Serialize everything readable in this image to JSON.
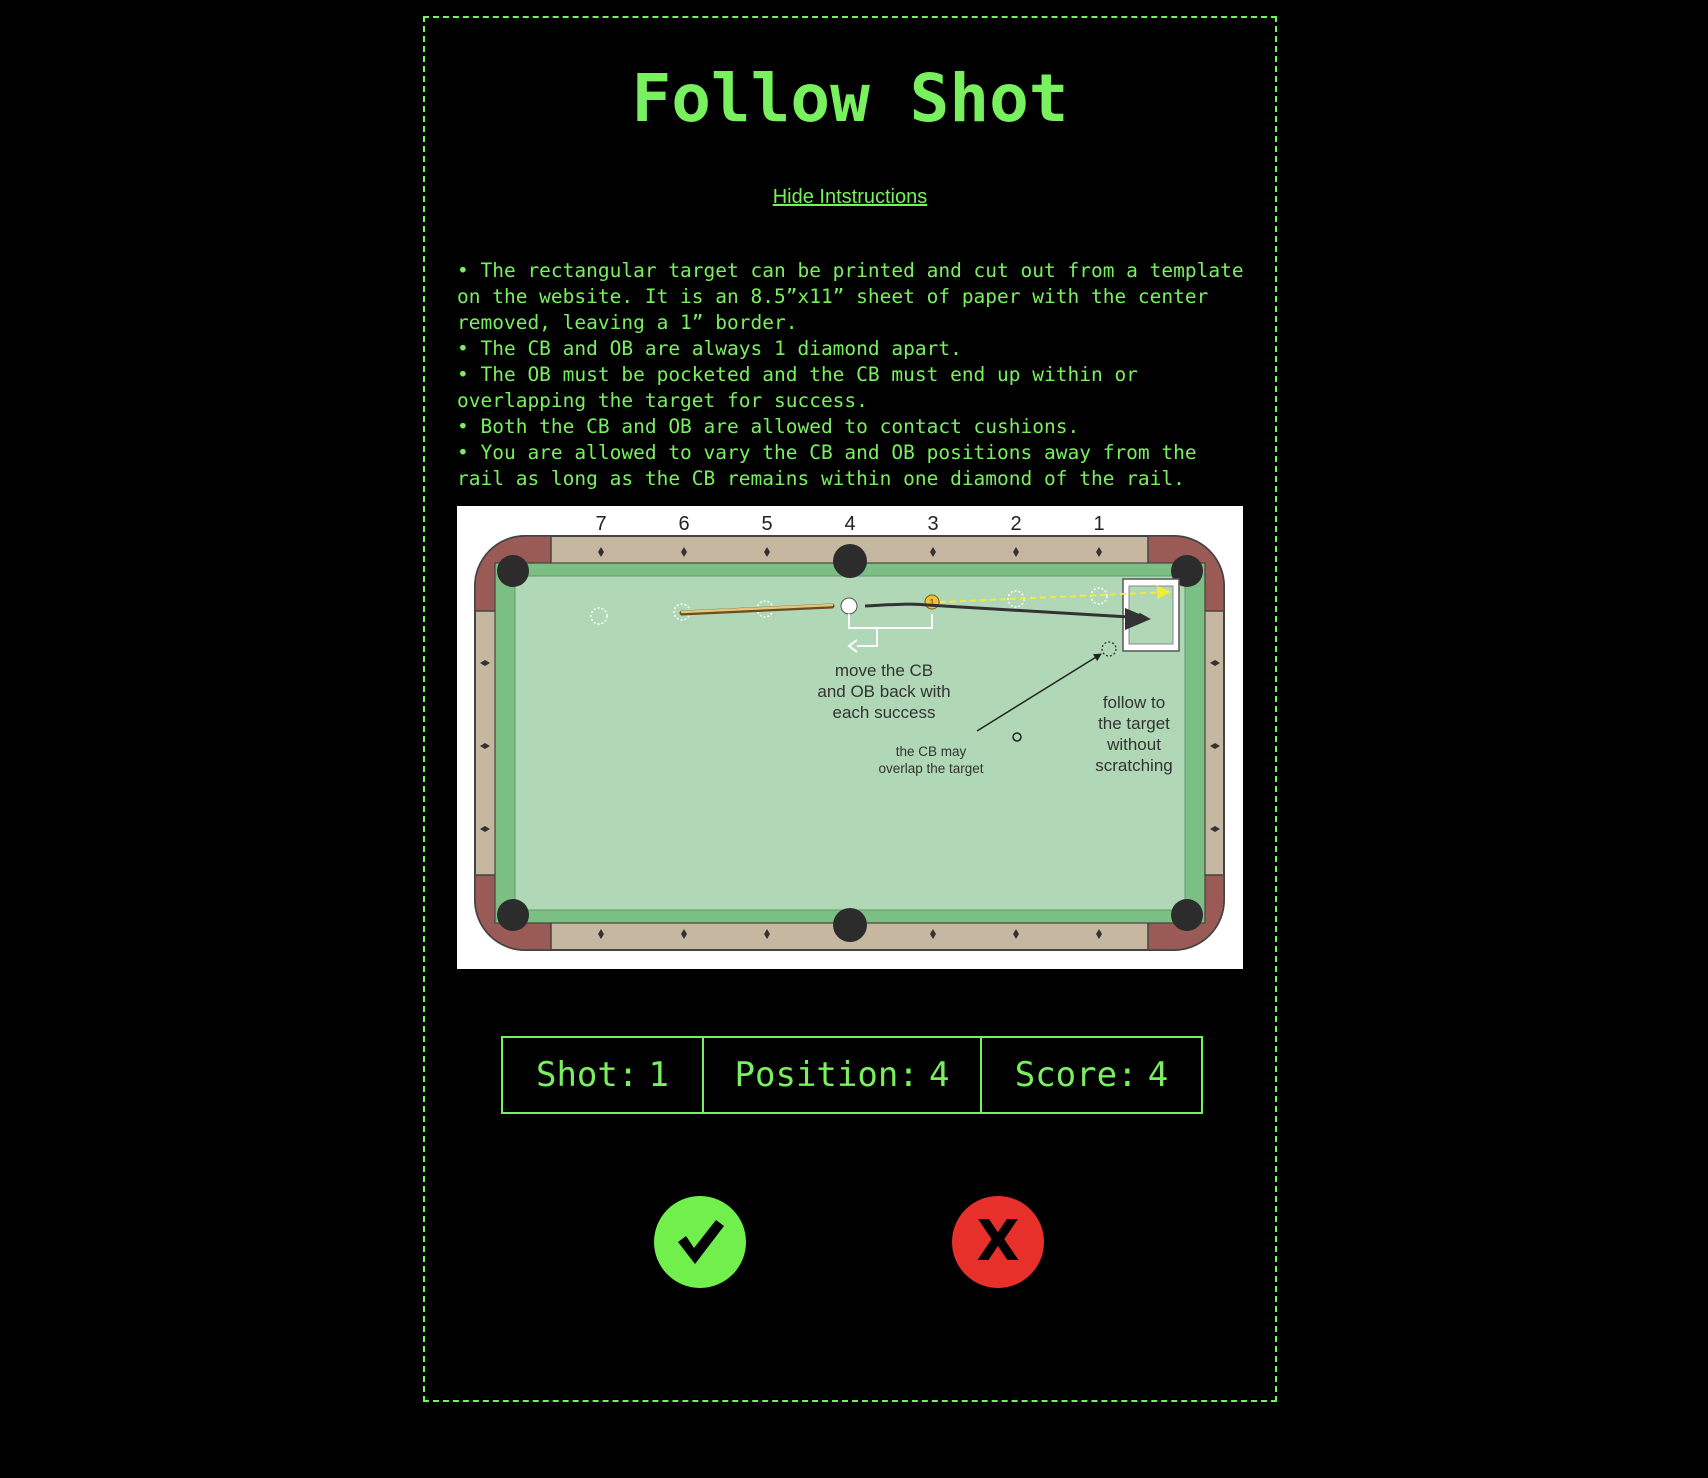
{
  "page": {
    "title": "Follow Shot",
    "toggle_label": "Hide Intstructions"
  },
  "instructions": [
    "• The rectangular target can be printed and cut out from a template on the website. It is an 8.5”x11” sheet of paper with the center removed, leaving a 1” border.",
    "• The CB and OB are always 1 diamond apart.",
    "• The OB must be pocketed and the CB must end up within or overlapping the target for success.",
    "• Both the CB and OB are allowed to contact cushions.",
    "• You are allowed to vary the CB and OB positions away from the rail as long as the CB remains within one diamond of the rail."
  ],
  "diagram": {
    "diamond_numbers": [
      "7",
      "6",
      "5",
      "4",
      "3",
      "2",
      "1"
    ],
    "ball_number": "1",
    "note_move": [
      "move the CB",
      "and OB back with",
      "each success"
    ],
    "note_follow": [
      "follow to",
      "the target",
      "without",
      "scratching"
    ],
    "note_overlap": [
      "the CB may",
      "overlap the target"
    ],
    "colors": {
      "cloth": "#b0d8b6",
      "cushion": "#7cbf85",
      "rail": "#c6b8a0",
      "corner": "#9a5a56",
      "pocket": "#2c2c2c",
      "object_ball": "#f2c230",
      "path_arrow": "#f4ea3a"
    }
  },
  "stats": {
    "shot_label": "Shot:",
    "shot_value": "1",
    "position_label": "Position:",
    "position_value": "4",
    "score_label": "Score:",
    "score_value": "4"
  },
  "actions": {
    "success_icon": "checkmark-icon",
    "fail_icon": "x-icon",
    "fail_glyph": "X"
  }
}
